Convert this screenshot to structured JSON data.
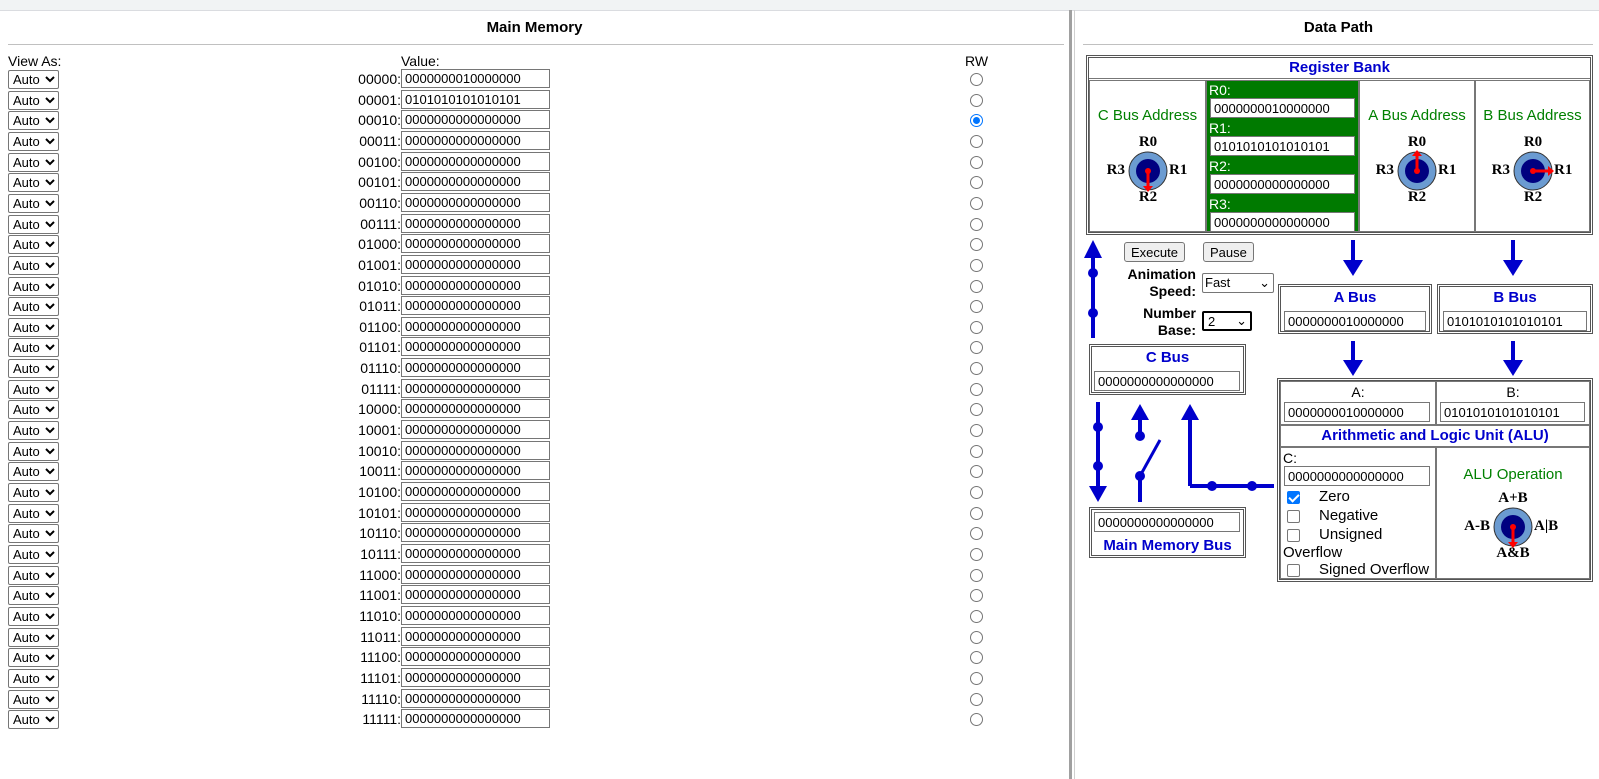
{
  "memory": {
    "title": "Main Memory",
    "view_as_label": "View As:",
    "value_label": "Value:",
    "rw_label": "RW",
    "view_option": "Auto",
    "selected_row": 2,
    "rows": [
      {
        "addr": "00000:",
        "value": "0000000010000000"
      },
      {
        "addr": "00001:",
        "value": "0101010101010101"
      },
      {
        "addr": "00010:",
        "value": "0000000000000000"
      },
      {
        "addr": "00011:",
        "value": "0000000000000000"
      },
      {
        "addr": "00100:",
        "value": "0000000000000000"
      },
      {
        "addr": "00101:",
        "value": "0000000000000000"
      },
      {
        "addr": "00110:",
        "value": "0000000000000000"
      },
      {
        "addr": "00111:",
        "value": "0000000000000000"
      },
      {
        "addr": "01000:",
        "value": "0000000000000000"
      },
      {
        "addr": "01001:",
        "value": "0000000000000000"
      },
      {
        "addr": "01010:",
        "value": "0000000000000000"
      },
      {
        "addr": "01011:",
        "value": "0000000000000000"
      },
      {
        "addr": "01100:",
        "value": "0000000000000000"
      },
      {
        "addr": "01101:",
        "value": "0000000000000000"
      },
      {
        "addr": "01110:",
        "value": "0000000000000000"
      },
      {
        "addr": "01111:",
        "value": "0000000000000000"
      },
      {
        "addr": "10000:",
        "value": "0000000000000000"
      },
      {
        "addr": "10001:",
        "value": "0000000000000000"
      },
      {
        "addr": "10010:",
        "value": "0000000000000000"
      },
      {
        "addr": "10011:",
        "value": "0000000000000000"
      },
      {
        "addr": "10100:",
        "value": "0000000000000000"
      },
      {
        "addr": "10101:",
        "value": "0000000000000000"
      },
      {
        "addr": "10110:",
        "value": "0000000000000000"
      },
      {
        "addr": "10111:",
        "value": "0000000000000000"
      },
      {
        "addr": "11000:",
        "value": "0000000000000000"
      },
      {
        "addr": "11001:",
        "value": "0000000000000000"
      },
      {
        "addr": "11010:",
        "value": "0000000000000000"
      },
      {
        "addr": "11011:",
        "value": "0000000000000000"
      },
      {
        "addr": "11100:",
        "value": "0000000000000000"
      },
      {
        "addr": "11101:",
        "value": "0000000000000000"
      },
      {
        "addr": "11110:",
        "value": "0000000000000000"
      },
      {
        "addr": "11111:",
        "value": "0000000000000000"
      }
    ]
  },
  "datapath": {
    "title": "Data Path",
    "register_bank": {
      "title": "Register Bank",
      "c_bus_address": "C Bus Address",
      "a_bus_address": "A Bus Address",
      "b_bus_address": "B Bus Address",
      "registers": [
        {
          "label": "R0:",
          "value": "0000000010000000"
        },
        {
          "label": "R1:",
          "value": "0101010101010101"
        },
        {
          "label": "R2:",
          "value": "0000000000000000"
        },
        {
          "label": "R3:",
          "value": "0000000000000000"
        }
      ],
      "dial_labels": {
        "top": "R0",
        "right": "R1",
        "bottom": "R2",
        "left": "R3"
      },
      "c_dial_selected": "R2",
      "a_dial_selected": "R0",
      "b_dial_selected": "R1"
    },
    "controls": {
      "execute": "Execute",
      "pause": "Pause",
      "animation_speed_label": "Animation Speed:",
      "animation_speed_value": "Fast",
      "number_base_label": "Number Base:",
      "number_base_value": "2"
    },
    "a_bus": {
      "title": "A Bus",
      "value": "0000000010000000"
    },
    "b_bus": {
      "title": "B Bus",
      "value": "0101010101010101"
    },
    "c_bus": {
      "title": "C Bus",
      "value": "0000000000000000"
    },
    "main_memory_bus": {
      "title": "Main Memory Bus",
      "value": "0000000000000000"
    },
    "alu": {
      "a_label": "A:",
      "a_value": "0000000010000000",
      "b_label": "B:",
      "b_value": "0101010101010101",
      "title": "Arithmetic and Logic Unit (ALU)",
      "c_label": "C:",
      "c_value": "0000000000000000",
      "flags": [
        {
          "label": "Zero",
          "checked": true
        },
        {
          "label": "Negative",
          "checked": false
        },
        {
          "label": "Unsigned Overflow",
          "checked": false
        },
        {
          "label": "Signed Overflow",
          "checked": false
        }
      ],
      "operation_label": "ALU Operation",
      "op_labels": {
        "top": "A+B",
        "right": "A|B",
        "bottom": "A&B",
        "left": "A-B"
      },
      "op_selected": "A&B"
    },
    "colors": {
      "bus_blue": "#0000cc",
      "register_green": "#007a00",
      "dial_fill": "#6b9bd1",
      "dial_center": "#000080",
      "pointer_red": "#ff0000"
    }
  }
}
